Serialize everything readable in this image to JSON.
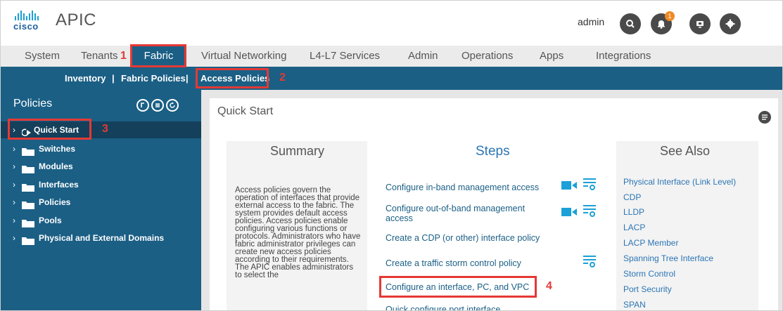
{
  "header": {
    "brand": "cisco",
    "app_title": "APIC",
    "username": "admin",
    "notification_count": "1",
    "icons": [
      "search-icon",
      "bell-icon",
      "monitor-icon",
      "gear-icon"
    ]
  },
  "main_tabs": {
    "system": "System",
    "tenants": "Tenants",
    "fabric": "Fabric",
    "virtual_networking": "Virtual Networking",
    "l4l7": "L4-L7 Services",
    "admin": "Admin",
    "operations": "Operations",
    "apps": "Apps",
    "integrations": "Integrations",
    "active": "Fabric"
  },
  "sub_tabs": {
    "inventory": "Inventory",
    "fabric_policies": "Fabric Policies",
    "access_policies": "Access Policies",
    "separator": "|",
    "active": "Access Policies"
  },
  "sidebar": {
    "title": "Policies",
    "items": [
      {
        "label": "Quick Start",
        "icon": "quickstart-icon",
        "active": true
      },
      {
        "label": "Switches",
        "icon": "folder-icon"
      },
      {
        "label": "Modules",
        "icon": "folder-icon"
      },
      {
        "label": "Interfaces",
        "icon": "folder-icon"
      },
      {
        "label": "Policies",
        "icon": "folder-icon"
      },
      {
        "label": "Pools",
        "icon": "folder-icon"
      },
      {
        "label": "Physical and External Domains",
        "icon": "folder-icon"
      }
    ]
  },
  "content": {
    "title": "Quick Start",
    "summary": {
      "heading": "Summary",
      "text": "Access policies govern the operation of interfaces that provide external access to the fabric. The system provides default access policies. Access policies enable configuring various functions or protocols. Administrators who have fabric administrator privileges can create new access policies according to their requirements. The APIC enables administrators to select the"
    },
    "steps": {
      "heading": "Steps",
      "items": [
        "Configure in-band management access",
        "Configure out-of-band management access",
        "Create a CDP (or other) interface policy",
        "Create a traffic storm control policy",
        "Configure an interface, PC, and VPC",
        "Quick configure port interface"
      ]
    },
    "see_also": {
      "heading": "See Also",
      "items": [
        "Physical Interface (Link Level)",
        "CDP",
        "LLDP",
        "LACP",
        "LACP Member",
        "Spanning Tree Interface",
        "Storm Control",
        "Port Security",
        "SPAN"
      ]
    }
  },
  "annotations": [
    "1",
    "2",
    "3",
    "4"
  ],
  "colors": {
    "primary": "#1b5f85",
    "active_row": "#14405b",
    "callout": "#e53935",
    "link": "#2c75b5"
  }
}
